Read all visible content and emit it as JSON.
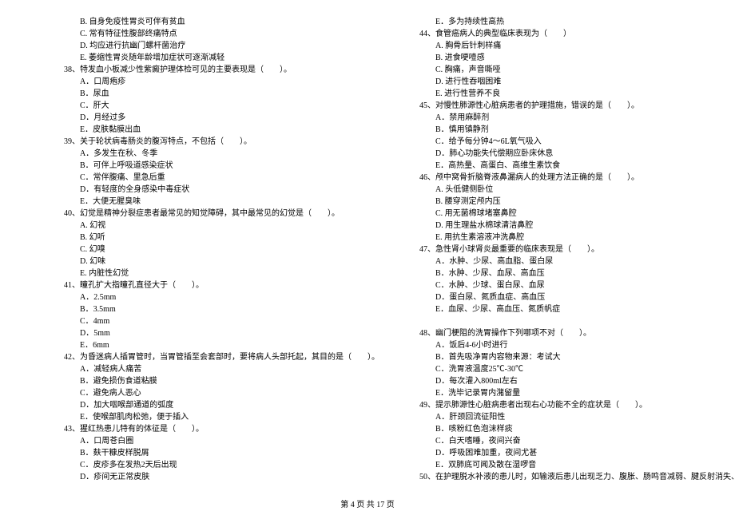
{
  "leftColumn": [
    {
      "cls": "indent-1",
      "text": "B. 自身免疫性胃炎可伴有贫血"
    },
    {
      "cls": "indent-1",
      "text": "C. 常有特征性腹部终痛特点"
    },
    {
      "cls": "indent-1",
      "text": "D. 均应进行抗幽门螺杆菌治疗"
    },
    {
      "cls": "indent-1",
      "text": "E. 萎缩性胃炎随年龄增加症状可逐渐减轻"
    },
    {
      "cls": "indent-q",
      "text": "38、特发血小板减少性紫癜护理体检可见的主要表现是（　　）。"
    },
    {
      "cls": "indent-1",
      "text": "A．口周疱疹"
    },
    {
      "cls": "indent-1",
      "text": "B．尿血"
    },
    {
      "cls": "indent-1",
      "text": "C．肝大"
    },
    {
      "cls": "indent-1",
      "text": "D．月经过多"
    },
    {
      "cls": "indent-1",
      "text": "E．皮肤黏膜出血"
    },
    {
      "cls": "indent-q",
      "text": "39、关于轮状病毒肠炎的腹泻特点，不包括（　　）。"
    },
    {
      "cls": "indent-1",
      "text": "A．多发生在秋、冬季"
    },
    {
      "cls": "indent-1",
      "text": "B．可伴上呼吸道感染症状"
    },
    {
      "cls": "indent-1",
      "text": "C．常伴腹痛、里急后重"
    },
    {
      "cls": "indent-1",
      "text": "D．有轻度的全身感染中毒症状"
    },
    {
      "cls": "indent-1",
      "text": "E．大便无腥臭味"
    },
    {
      "cls": "indent-q",
      "text": "40、幻觉是精神分裂症患者最常见的知觉障碍，其中最常见的幻觉是（　　）。"
    },
    {
      "cls": "indent-1",
      "text": "A. 幻视"
    },
    {
      "cls": "indent-1",
      "text": "B. 幻听"
    },
    {
      "cls": "indent-1",
      "text": "C. 幻嗅"
    },
    {
      "cls": "indent-1",
      "text": "D. 幻味"
    },
    {
      "cls": "indent-1",
      "text": "E. 内脏性幻觉"
    },
    {
      "cls": "indent-q",
      "text": "41、瞳孔扩大指瞳孔直径大于（　　）。"
    },
    {
      "cls": "indent-1",
      "text": "A．2.5mm"
    },
    {
      "cls": "indent-1",
      "text": "B．3.5mm"
    },
    {
      "cls": "indent-1",
      "text": "C．4mm"
    },
    {
      "cls": "indent-1",
      "text": "D．5mm"
    },
    {
      "cls": "indent-1",
      "text": "E．6mm"
    },
    {
      "cls": "indent-q",
      "text": "42、为昏迷病人插胃管时，当胃管插至会套部时，要将病人头部托起，其目的是（　　）。"
    },
    {
      "cls": "indent-1",
      "text": "A．减轻病人痛苦"
    },
    {
      "cls": "indent-1",
      "text": "B．避免损伤食道粘膜"
    },
    {
      "cls": "indent-1",
      "text": "C．避免病人恶心"
    },
    {
      "cls": "indent-1",
      "text": "D．加大咽喉部通道的弧度"
    },
    {
      "cls": "indent-1",
      "text": "E．使喉部肌肉松弛，便于插入"
    },
    {
      "cls": "indent-q",
      "text": "43、猩红热患儿特有的体征是（　　）。"
    },
    {
      "cls": "indent-1",
      "text": "A．口周苍白圈"
    },
    {
      "cls": "indent-1",
      "text": "B．麸干糠皮样脱屑"
    },
    {
      "cls": "indent-1",
      "text": "C．皮疹多在发热2天后出现"
    },
    {
      "cls": "indent-1",
      "text": "D．疹间无正常皮肤"
    }
  ],
  "rightColumn": [
    {
      "cls": "indent-1",
      "text": "E．多为持续性高热"
    },
    {
      "cls": "indent-q",
      "text": "44、食管癌病人的典型临床表现为（　　）"
    },
    {
      "cls": "indent-1",
      "text": "A. 胸骨后针刺样痛"
    },
    {
      "cls": "indent-1",
      "text": "B. 进食哽噎感"
    },
    {
      "cls": "indent-1",
      "text": "C. 胸痛，声音嘶哑"
    },
    {
      "cls": "indent-1",
      "text": "D. 进行性吞咽困难"
    },
    {
      "cls": "indent-1",
      "text": "E. 进行性营养不良"
    },
    {
      "cls": "indent-q",
      "text": "45、对慢性肺源性心脏病患者的护理措施，错误的是（　　）。"
    },
    {
      "cls": "indent-1",
      "text": "A．禁用麻醉剂"
    },
    {
      "cls": "indent-1",
      "text": "B．慎用镇静剂"
    },
    {
      "cls": "indent-1",
      "text": "C．给予每分钟4～6L氧气吸入"
    },
    {
      "cls": "indent-1",
      "text": "D．肺心功能失代偿期应卧床休息"
    },
    {
      "cls": "indent-1",
      "text": "E．高热量、高蛋白、高维生素饮食"
    },
    {
      "cls": "indent-q",
      "text": "46、颅中窝骨折脑脊液鼻漏病人的处理方法正确的是（　　）。"
    },
    {
      "cls": "indent-1",
      "text": "A. 头低健侧卧位"
    },
    {
      "cls": "indent-1",
      "text": "B. 腰穿测定颅内压"
    },
    {
      "cls": "indent-1",
      "text": "C. 用无菌棉球堵塞鼻腔"
    },
    {
      "cls": "indent-1",
      "text": "D. 用生理盐水棉球清洁鼻腔"
    },
    {
      "cls": "indent-1",
      "text": "E. 用抗生素溶液冲洗鼻腔"
    },
    {
      "cls": "indent-q",
      "text": "47、急性肾小球肾炎最重要的临床表现是（　　）。"
    },
    {
      "cls": "indent-1",
      "text": "A．水肿、少尿、高血脂、蛋白尿"
    },
    {
      "cls": "indent-1",
      "text": "B．水肿、少尿、血尿、高血压"
    },
    {
      "cls": "indent-1",
      "text": "C．水肿、少球、蛋白尿、血尿"
    },
    {
      "cls": "indent-1",
      "text": "D．蛋白尿、氮质血症、高血压"
    },
    {
      "cls": "indent-1",
      "text": "E．血尿、少尿、高血压、氮质帆症"
    },
    {
      "cls": "",
      "text": "　"
    },
    {
      "cls": "indent-q",
      "text": "48、幽门梗阻的洗胃操作下列哪项不对（　　）。"
    },
    {
      "cls": "indent-1",
      "text": "A．饭后4-6小时进行"
    },
    {
      "cls": "indent-1",
      "text": "B．首先吸净胃内容物来源：考试大"
    },
    {
      "cls": "indent-1",
      "text": "C．洗胃液温度25℃-30℃"
    },
    {
      "cls": "indent-1",
      "text": "D．每次灌入800ml左右"
    },
    {
      "cls": "indent-1",
      "text": "E．洗毕记录胃内潴留量"
    },
    {
      "cls": "indent-q",
      "text": "49、提示肺源性心脏病患者出现右心功能不全的症状是（　　）。"
    },
    {
      "cls": "indent-1",
      "text": "A．肝颈回流征阳性"
    },
    {
      "cls": "indent-1",
      "text": "B．咳粉红色泡沫样痰"
    },
    {
      "cls": "indent-1",
      "text": "C．白天嗜睡，夜间兴奋"
    },
    {
      "cls": "indent-1",
      "text": "D．呼吸困难加重，夜间尤甚"
    },
    {
      "cls": "indent-1",
      "text": "E．双肺底可闻及散在湿啰音"
    },
    {
      "cls": "indent-q",
      "text": "50、在护理脱水补液的患儿时，如输液后患儿出现乏力、腹胀、肠鸣音减弱、腱反射消失、心"
    }
  ],
  "footer": "第 4 页  共 17 页"
}
